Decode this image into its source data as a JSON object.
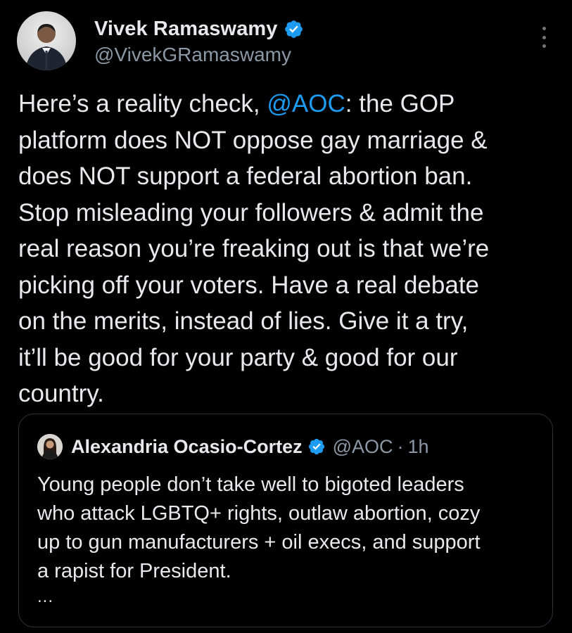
{
  "tweet": {
    "author": {
      "display_name": "Vivek Ramaswamy",
      "handle": "@VivekGRamaswamy",
      "verified_icon": "verified-badge-icon"
    },
    "more_icon": "more-options-icon",
    "text_before_mention": "Here’s a reality check, ",
    "mention": "@AOC",
    "text_after_mention": ": the GOP\nplatform does NOT oppose gay marriage &\ndoes NOT support a federal abortion ban.\nStop misleading your followers & admit the\nreal reason you’re freaking out is that we’re\npicking off your voters. Have a real debate\non the merits, instead of lies. Give it a try,\nit’ll be good for your party & good for our\ncountry."
  },
  "quote": {
    "author": {
      "display_name": "Alexandria Ocasio-Cortez",
      "handle": "@AOC",
      "separator": "·",
      "time": "1h"
    },
    "text": "Young people don’t take well to bigoted leaders\nwho attack LGBTQ+ rights, outlaw abortion, cozy\nup to gun manufacturers + oil execs, and support\na rapist for President.",
    "ellipsis": "..."
  },
  "colors": {
    "background": "#000000",
    "text": "#e7e9ea",
    "secondary": "#8b98a5",
    "link": "#1d9bf0",
    "verified": "#1d9bf0",
    "border": "#2f3336"
  }
}
